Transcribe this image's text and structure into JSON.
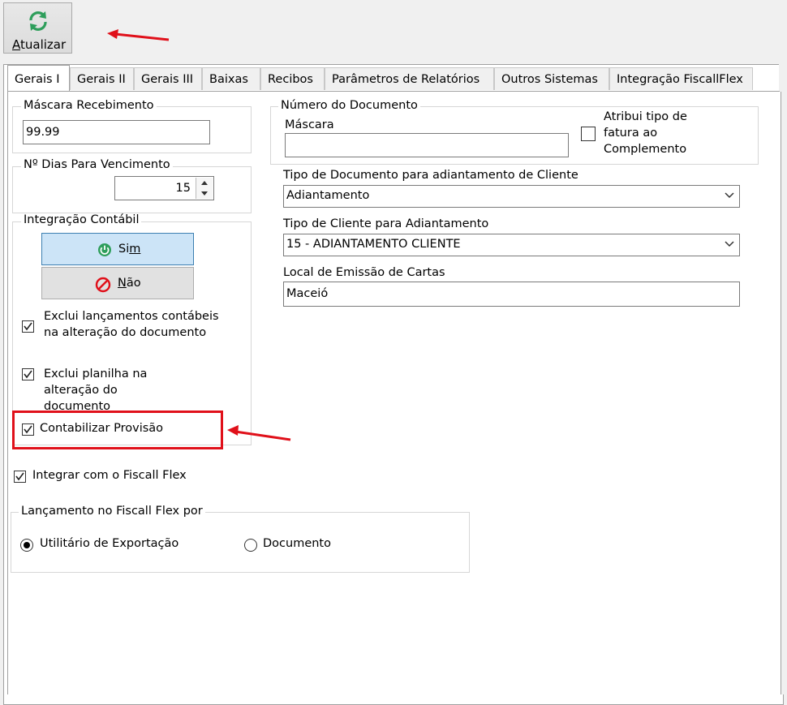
{
  "toolbar": {
    "refresh_label_hotkey": "A",
    "refresh_label_rest": "tualizar",
    "refresh_icon": "refresh-icon"
  },
  "tabs": [
    {
      "label": "Gerais I",
      "active": true
    },
    {
      "label": "Gerais II"
    },
    {
      "label": "Gerais III"
    },
    {
      "label": "Baixas"
    },
    {
      "label": "Recibos"
    },
    {
      "label": "Parâmetros de Relatórios"
    },
    {
      "label": "Outros Sistemas"
    },
    {
      "label": "Integração FiscallFlex"
    }
  ],
  "mascara_recebimento": {
    "title": "Máscara Recebimento",
    "value": "99.99"
  },
  "dias_vencimento": {
    "title": "Nº Dias Para Vencimento",
    "value": "15"
  },
  "integracao_contabil": {
    "title": "Integração Contábil",
    "sim_hotkey_prefix": "Si",
    "sim_hotkey": "m",
    "nao_hotkey": "N",
    "nao_rest": "ão",
    "exclui_lancamentos": "Exclui lançamentos contábeis na alteração do documento",
    "exclui_lancamentos_checked": true,
    "exclui_planilha": "Exclui planilha na alteração do documento",
    "exclui_planilha_checked": true,
    "contabilizar_provisao": "Contabilizar Provisão",
    "contabilizar_provisao_checked": true
  },
  "numero_documento": {
    "title": "Número do Documento",
    "mascara_label": "Máscara",
    "mascara_value": "",
    "atribui_tipo": "Atribui tipo de fatura ao Complemento",
    "atribui_tipo_checked": false
  },
  "tipo_documento": {
    "label": "Tipo de Documento para adiantamento de Cliente",
    "value": "Adiantamento"
  },
  "tipo_cliente": {
    "label": "Tipo de Cliente para Adiantamento",
    "value": "15 - ADIANTAMENTO CLIENTE"
  },
  "local_emissao": {
    "label": "Local de Emissão de Cartas",
    "value": "Maceió"
  },
  "integrar_fiscall": {
    "label": "Integrar com o Fiscall Flex",
    "checked": true
  },
  "lancamento_fiscall": {
    "title": "Lançamento no Fiscall Flex por",
    "options": [
      {
        "label": "Utilitário de Exportação",
        "selected": true
      },
      {
        "label": "Documento",
        "selected": false
      }
    ]
  },
  "colors": {
    "annotation_red": "#e0101a",
    "refresh_green": "#2e9e5b",
    "sim_blue": "#cce4f7"
  }
}
